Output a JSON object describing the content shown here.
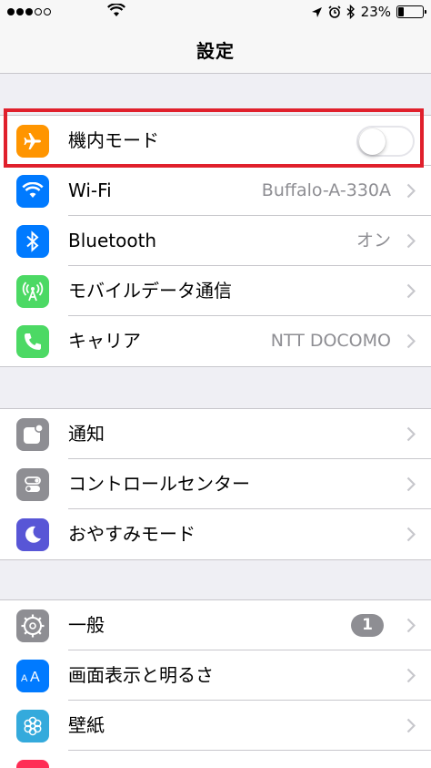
{
  "status_bar": {
    "battery_text": "23%",
    "battery_level": 0.23
  },
  "nav": {
    "title": "設定"
  },
  "group1": [
    {
      "label": "機内モード",
      "icon": "airplane-icon",
      "color": "#ff9500",
      "type": "toggle",
      "on": false
    },
    {
      "label": "Wi-Fi",
      "icon": "wifi-icon",
      "color": "#007aff",
      "value": "Buffalo-A-330A"
    },
    {
      "label": "Bluetooth",
      "icon": "bluetooth-icon",
      "color": "#007aff",
      "value": "オン"
    },
    {
      "label": "モバイルデータ通信",
      "icon": "cellular-antenna-icon",
      "color": "#4cd964",
      "value": ""
    },
    {
      "label": "キャリア",
      "icon": "phone-icon",
      "color": "#4cd964",
      "value": "NTT DOCOMO"
    }
  ],
  "group2": [
    {
      "label": "通知",
      "icon": "notifications-icon",
      "color": "#8e8e93"
    },
    {
      "label": "コントロールセンター",
      "icon": "control-center-icon",
      "color": "#8e8e93"
    },
    {
      "label": "おやすみモード",
      "icon": "moon-icon",
      "color": "#5856d6"
    }
  ],
  "group3": [
    {
      "label": "一般",
      "icon": "gear-icon",
      "color": "#8e8e93",
      "badge": "1"
    },
    {
      "label": "画面表示と明るさ",
      "icon": "display-brightness-icon",
      "color": "#007aff"
    },
    {
      "label": "壁紙",
      "icon": "wallpaper-icon",
      "color": "#34aadc"
    },
    {
      "label": "",
      "icon": "sounds-icon",
      "color": "#ff2d55"
    }
  ]
}
